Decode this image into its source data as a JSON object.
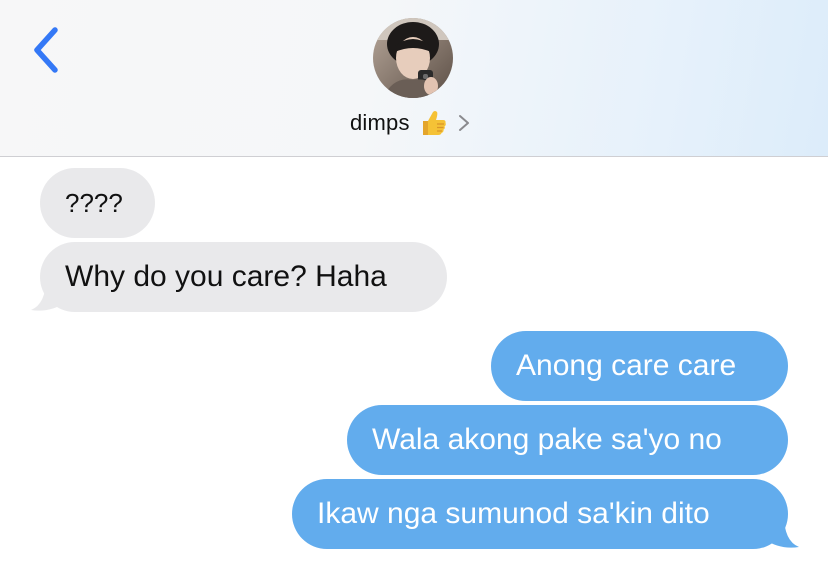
{
  "header": {
    "back_icon": "chevron-left-icon",
    "contact_name": "dimps",
    "contact_emoji": "thumbs-up-icon",
    "disclosure_icon": "chevron-right-icon",
    "accent_color": "#3478f6"
  },
  "messages": [
    {
      "sender": "contact",
      "text": "????"
    },
    {
      "sender": "contact",
      "text": "Why do you care? Haha"
    },
    {
      "sender": "me",
      "text": "Anong care care"
    },
    {
      "sender": "me",
      "text": "Wala akong pake sa'yo no"
    },
    {
      "sender": "me",
      "text": "Ikaw nga sumunod sa'kin dito"
    }
  ],
  "colors": {
    "incoming_bubble": "#e9e9eb",
    "outgoing_bubble": "#62aced",
    "incoming_text": "#111111",
    "outgoing_text": "#ffffff"
  }
}
